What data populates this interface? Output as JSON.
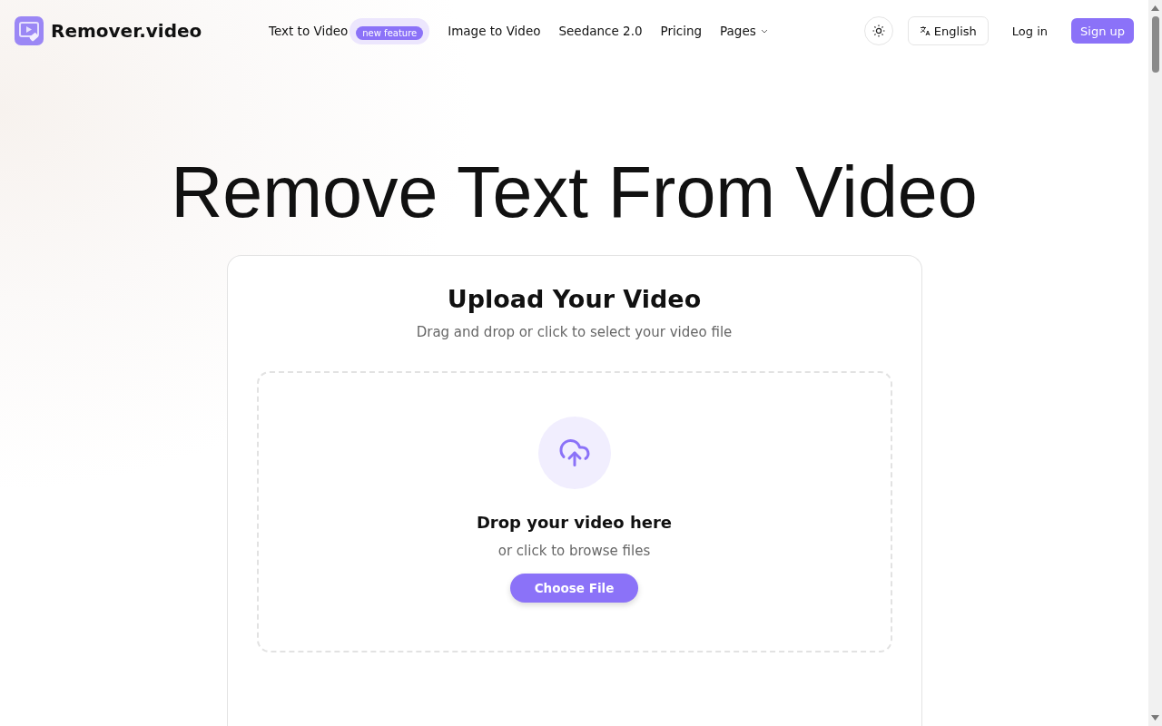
{
  "brand": {
    "name": "Remover.video"
  },
  "nav": [
    {
      "label": "Text to Video",
      "badge": "new feature",
      "dropdown": false
    },
    {
      "label": "Image to Video",
      "dropdown": false
    },
    {
      "label": "Seedance 2.0",
      "dropdown": false
    },
    {
      "label": "Pricing",
      "dropdown": false
    },
    {
      "label": "Pages",
      "dropdown": true
    }
  ],
  "actions": {
    "language": "English",
    "login": "Log in",
    "signup": "Sign up"
  },
  "hero": {
    "title": "Remove Text From Video"
  },
  "upload": {
    "title": "Upload Your Video",
    "subtitle": "Drag and drop or click to select your video file",
    "drop_title": "Drop your video here",
    "drop_hint": "or click to browse files",
    "button": "Choose File"
  }
}
